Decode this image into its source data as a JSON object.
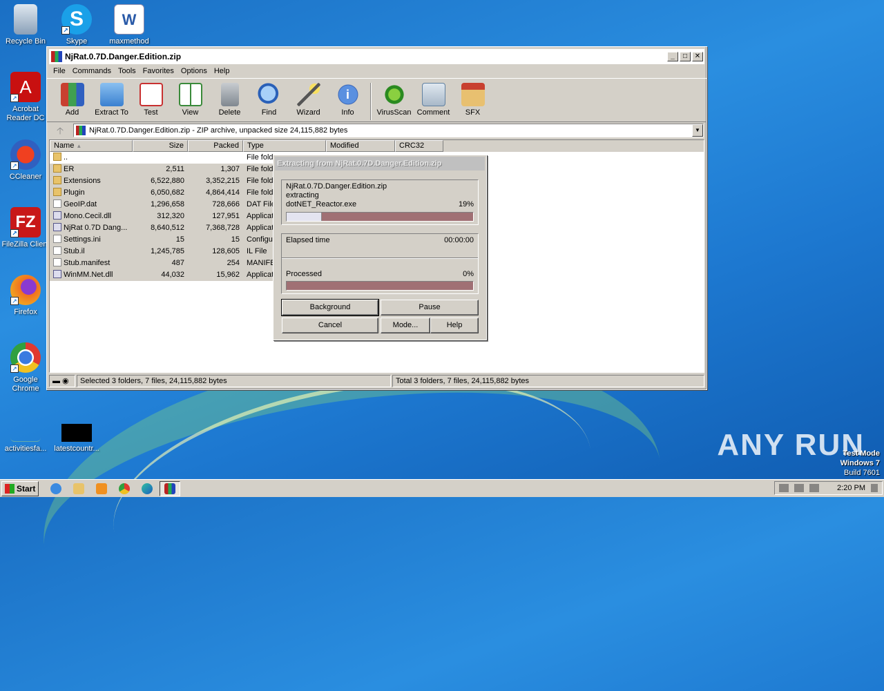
{
  "desktop": {
    "icons": [
      {
        "label": "Recycle Bin"
      },
      {
        "label": "Skype"
      },
      {
        "label": "maxmethod"
      },
      {
        "label": "Acrobat Reader DC"
      },
      {
        "label": "CCleaner"
      },
      {
        "label": "FileZilla Client"
      },
      {
        "label": "Firefox"
      },
      {
        "label": "Google Chrome"
      },
      {
        "label": "activitiesfa..."
      },
      {
        "label": "latestcountr..."
      }
    ],
    "watermark": "ANY RUN",
    "os_info": {
      "line1": "Test Mode",
      "line2": "Windows 7",
      "line3": "Build 7601"
    }
  },
  "window": {
    "title": "NjRat.0.7D.Danger.Edition.zip",
    "controls": {
      "minimize": "_",
      "maximize": "□",
      "close": "✕"
    },
    "menu": [
      "File",
      "Commands",
      "Tools",
      "Favorites",
      "Options",
      "Help"
    ],
    "toolbar": [
      {
        "label": "Add",
        "color": "#c84030"
      },
      {
        "label": "Extract To",
        "color": "#4a90d8"
      },
      {
        "label": "Test",
        "color": "#d04040"
      },
      {
        "label": "View",
        "color": "#3a8a3a"
      },
      {
        "label": "Delete",
        "color": "#909090"
      },
      {
        "label": "Find",
        "color": "#3a70c8"
      },
      {
        "label": "Wizard",
        "color": "#c0a020"
      },
      {
        "label": "Info",
        "color": "#2a60b8"
      },
      {
        "label": "VirusScan",
        "color": "#3aa030"
      },
      {
        "label": "Comment",
        "color": "#7090b0"
      },
      {
        "label": "SFX",
        "color": "#d06030"
      }
    ],
    "address": "NjRat.0.7D.Danger.Edition.zip - ZIP archive, unpacked size 24,115,882 bytes",
    "columns": {
      "name": "Name",
      "size": "Size",
      "packed": "Packed",
      "type": "Type",
      "modified": "Modified",
      "crc": "CRC32"
    },
    "files": [
      {
        "name": "..",
        "size": "",
        "packed": "",
        "type": "File fold",
        "kind": "folder"
      },
      {
        "name": "ER",
        "size": "2,511",
        "packed": "1,307",
        "type": "File fold",
        "kind": "folder"
      },
      {
        "name": "Extensions",
        "size": "6,522,880",
        "packed": "3,352,215",
        "type": "File fold",
        "kind": "folder"
      },
      {
        "name": "Plugin",
        "size": "6,050,682",
        "packed": "4,864,414",
        "type": "File fold",
        "kind": "folder"
      },
      {
        "name": "GeoIP.dat",
        "size": "1,296,658",
        "packed": "728,666",
        "type": "DAT File",
        "kind": "file"
      },
      {
        "name": "Mono.Cecil.dll",
        "size": "312,320",
        "packed": "127,951",
        "type": "Applicat",
        "kind": "exe"
      },
      {
        "name": "NjRat 0.7D Dang...",
        "size": "8,640,512",
        "packed": "7,368,728",
        "type": "Applicat",
        "kind": "exe"
      },
      {
        "name": "Settings.ini",
        "size": "15",
        "packed": "15",
        "type": "Configu",
        "kind": "file"
      },
      {
        "name": "Stub.il",
        "size": "1,245,785",
        "packed": "128,605",
        "type": "IL File",
        "kind": "file"
      },
      {
        "name": "Stub.manifest",
        "size": "487",
        "packed": "254",
        "type": "MANIFE",
        "kind": "file"
      },
      {
        "name": "WinMM.Net.dll",
        "size": "44,032",
        "packed": "15,962",
        "type": "Applicat",
        "kind": "exe"
      }
    ],
    "status_left": "Selected 3 folders, 7 files, 24,115,882 bytes",
    "status_right": "Total 3 folders, 7 files, 24,115,882 bytes"
  },
  "dialog": {
    "title": "Extracting from NjRat.0.7D.Danger.Edition.zip",
    "archive": "NjRat.0.7D.Danger.Edition.zip",
    "action": "extracting",
    "current_file": "dotNET_Reactor.exe",
    "file_percent_text": "19%",
    "file_progress": 0.19,
    "elapsed_label": "Elapsed time",
    "elapsed_value": "00:00:00",
    "processed_label": "Processed",
    "processed_percent_text": "0%",
    "processed_progress": 0.0,
    "buttons": {
      "background": "Background",
      "pause": "Pause",
      "cancel": "Cancel",
      "mode": "Mode...",
      "help": "Help"
    }
  },
  "taskbar": {
    "start": "Start",
    "clock": "2:20 PM"
  }
}
